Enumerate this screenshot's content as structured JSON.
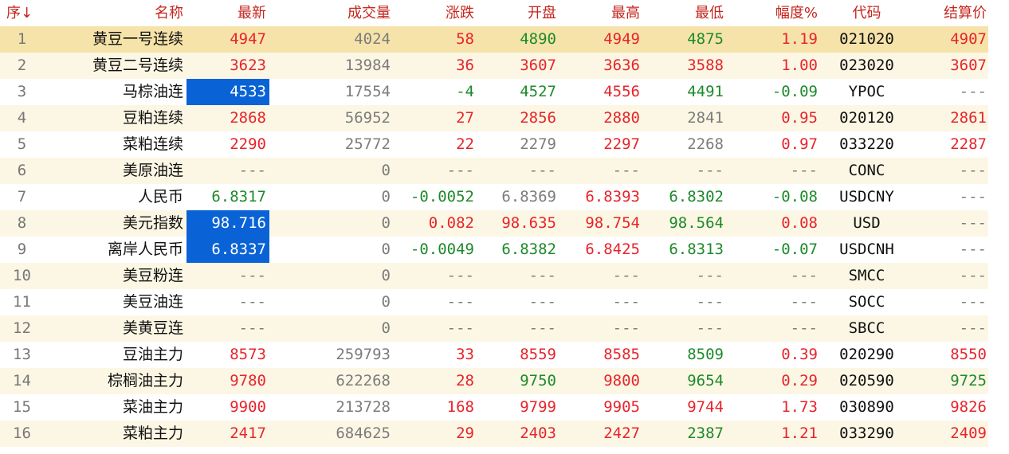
{
  "header": {
    "seq": "序↓",
    "name": "名称",
    "last": "最新",
    "volume": "成交量",
    "change": "涨跌",
    "open": "开盘",
    "high": "最高",
    "low": "最低",
    "pct": "幅度%",
    "code": "代码",
    "settle": "结算价"
  },
  "colors": {
    "up": "#e8242b",
    "down": "#1d8a2b",
    "flat": "#7c7c7c",
    "header": "#c4261d",
    "selected_row": "#f6e3a9",
    "highlight": "#0a63d6"
  },
  "rows": [
    {
      "seq": "1",
      "name": "黄豆一号连续",
      "last": "4947",
      "volume": "4024",
      "change": "58",
      "open": "4890",
      "high": "4949",
      "low": "4875",
      "pct": "1.19",
      "code": "021020",
      "settle": "4907"
    },
    {
      "seq": "2",
      "name": "黄豆二号连续",
      "last": "3623",
      "volume": "13984",
      "change": "36",
      "open": "3607",
      "high": "3636",
      "low": "3588",
      "pct": "1.00",
      "code": "023020",
      "settle": "3607"
    },
    {
      "seq": "3",
      "name": "马棕油连",
      "last": "4533",
      "volume": "17554",
      "change": "-4",
      "open": "4527",
      "high": "4556",
      "low": "4491",
      "pct": "-0.09",
      "code": "YPOC",
      "settle": "---"
    },
    {
      "seq": "4",
      "name": "豆粕连续",
      "last": "2868",
      "volume": "56952",
      "change": "27",
      "open": "2856",
      "high": "2880",
      "low": "2841",
      "pct": "0.95",
      "code": "020120",
      "settle": "2861"
    },
    {
      "seq": "5",
      "name": "菜粕连续",
      "last": "2290",
      "volume": "25772",
      "change": "22",
      "open": "2279",
      "high": "2297",
      "low": "2268",
      "pct": "0.97",
      "code": "033220",
      "settle": "2287"
    },
    {
      "seq": "6",
      "name": "美原油连",
      "last": "---",
      "volume": "0",
      "change": "---",
      "open": "---",
      "high": "---",
      "low": "---",
      "pct": "---",
      "code": "CONC",
      "settle": "---"
    },
    {
      "seq": "7",
      "name": "人民币",
      "last": "6.8317",
      "volume": "0",
      "change": "-0.0052",
      "open": "6.8369",
      "high": "6.8393",
      "low": "6.8302",
      "pct": "-0.08",
      "code": "USDCNY",
      "settle": "---"
    },
    {
      "seq": "8",
      "name": "美元指数",
      "last": "98.716",
      "volume": "0",
      "change": "0.082",
      "open": "98.635",
      "high": "98.754",
      "low": "98.564",
      "pct": "0.08",
      "code": "USD",
      "settle": "---"
    },
    {
      "seq": "9",
      "name": "离岸人民币",
      "last": "6.8337",
      "volume": "0",
      "change": "-0.0049",
      "open": "6.8382",
      "high": "6.8425",
      "low": "6.8313",
      "pct": "-0.07",
      "code": "USDCNH",
      "settle": "---"
    },
    {
      "seq": "10",
      "name": "美豆粉连",
      "last": "---",
      "volume": "0",
      "change": "---",
      "open": "---",
      "high": "---",
      "low": "---",
      "pct": "---",
      "code": "SMCC",
      "settle": "---"
    },
    {
      "seq": "11",
      "name": "美豆油连",
      "last": "---",
      "volume": "0",
      "change": "---",
      "open": "---",
      "high": "---",
      "low": "---",
      "pct": "---",
      "code": "SOCC",
      "settle": "---"
    },
    {
      "seq": "12",
      "name": "美黄豆连",
      "last": "---",
      "volume": "0",
      "change": "---",
      "open": "---",
      "high": "---",
      "low": "---",
      "pct": "---",
      "code": "SBCC",
      "settle": "---"
    },
    {
      "seq": "13",
      "name": "豆油主力",
      "last": "8573",
      "volume": "259793",
      "change": "33",
      "open": "8559",
      "high": "8585",
      "low": "8509",
      "pct": "0.39",
      "code": "020290",
      "settle": "8550"
    },
    {
      "seq": "14",
      "name": "棕榈油主力",
      "last": "9780",
      "volume": "622268",
      "change": "28",
      "open": "9750",
      "high": "9800",
      "low": "9654",
      "pct": "0.29",
      "code": "020590",
      "settle": "9725"
    },
    {
      "seq": "15",
      "name": "菜油主力",
      "last": "9900",
      "volume": "213728",
      "change": "168",
      "open": "9799",
      "high": "9905",
      "low": "9744",
      "pct": "1.73",
      "code": "030890",
      "settle": "9826"
    },
    {
      "seq": "16",
      "name": "菜粕主力",
      "last": "2417",
      "volume": "684625",
      "change": "29",
      "open": "2403",
      "high": "2427",
      "low": "2387",
      "pct": "1.21",
      "code": "033290",
      "settle": "2409"
    }
  ],
  "colorclass": [
    {
      "last": "up",
      "change": "up",
      "open": "down",
      "high": "up",
      "low": "down",
      "pct": "up",
      "settle": "up"
    },
    {
      "last": "up",
      "change": "up",
      "open": "up",
      "high": "up",
      "low": "up",
      "pct": "up",
      "settle": "up"
    },
    {
      "last": "hl",
      "change": "down",
      "open": "down",
      "high": "up",
      "low": "down",
      "pct": "down",
      "settle": "flat"
    },
    {
      "last": "up",
      "change": "up",
      "open": "up",
      "high": "up",
      "low": "flat",
      "pct": "up",
      "settle": "up"
    },
    {
      "last": "up",
      "change": "up",
      "open": "flat",
      "high": "up",
      "low": "flat",
      "pct": "up",
      "settle": "up"
    },
    {
      "last": "flat",
      "change": "flat",
      "open": "flat",
      "high": "flat",
      "low": "flat",
      "pct": "flat",
      "settle": "flat"
    },
    {
      "last": "down",
      "change": "down",
      "open": "flat",
      "high": "up",
      "low": "down",
      "pct": "down",
      "settle": "flat"
    },
    {
      "last": "hl",
      "change": "up",
      "open": "up",
      "high": "up",
      "low": "down",
      "pct": "up",
      "settle": "flat"
    },
    {
      "last": "hl",
      "change": "down",
      "open": "down",
      "high": "up",
      "low": "down",
      "pct": "down",
      "settle": "flat"
    },
    {
      "last": "flat",
      "change": "flat",
      "open": "flat",
      "high": "flat",
      "low": "flat",
      "pct": "flat",
      "settle": "flat"
    },
    {
      "last": "flat",
      "change": "flat",
      "open": "flat",
      "high": "flat",
      "low": "flat",
      "pct": "flat",
      "settle": "flat"
    },
    {
      "last": "flat",
      "change": "flat",
      "open": "flat",
      "high": "flat",
      "low": "flat",
      "pct": "flat",
      "settle": "flat"
    },
    {
      "last": "up",
      "change": "up",
      "open": "up",
      "high": "up",
      "low": "down",
      "pct": "up",
      "settle": "up"
    },
    {
      "last": "up",
      "change": "up",
      "open": "down",
      "high": "up",
      "low": "down",
      "pct": "up",
      "settle": "down"
    },
    {
      "last": "up",
      "change": "up",
      "open": "up",
      "high": "up",
      "low": "up",
      "pct": "up",
      "settle": "up"
    },
    {
      "last": "up",
      "change": "up",
      "open": "up",
      "high": "up",
      "low": "down",
      "pct": "up",
      "settle": "up"
    }
  ],
  "selected_row_index": 0
}
